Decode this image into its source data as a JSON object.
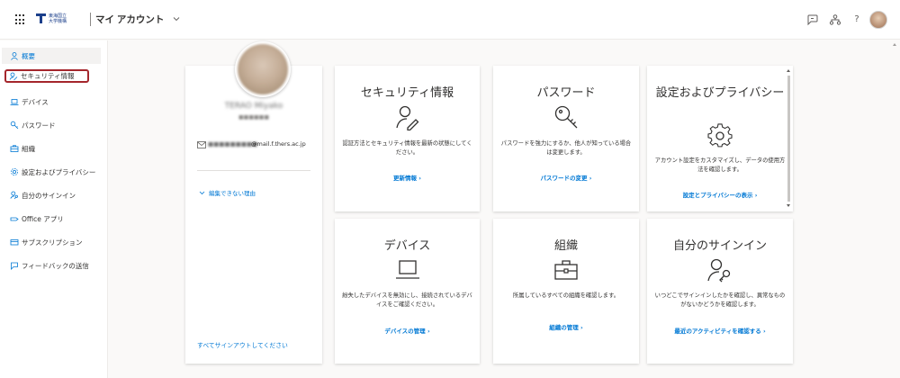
{
  "header": {
    "org_line1": "東海国立",
    "org_line2": "大学機構",
    "app_title": "マイ アカウント",
    "icons": [
      "waffle-icon",
      "feedback-icon",
      "org-chart-icon",
      "help-icon",
      "avatar"
    ],
    "help_label": "?"
  },
  "sidebar": {
    "items": [
      {
        "label": "概要",
        "icon": "person-icon"
      },
      {
        "label": "セキュリティ情報",
        "icon": "security-info-icon"
      },
      {
        "label": "デバイス",
        "icon": "laptop-icon"
      },
      {
        "label": "パスワード",
        "icon": "key-icon"
      },
      {
        "label": "組織",
        "icon": "briefcase-icon"
      },
      {
        "label": "設定およびプライバシー",
        "icon": "gear-icon"
      },
      {
        "label": "自分のサインイン",
        "icon": "signin-icon"
      },
      {
        "label": "Office アプリ",
        "icon": "office-apps-icon"
      },
      {
        "label": "サブスクリプション",
        "icon": "subscription-icon"
      },
      {
        "label": "フィードバックの送信",
        "icon": "feedback-icon"
      }
    ]
  },
  "profile": {
    "name": "TERAO Miyako",
    "subtitle": "■■■■■■",
    "email_local": "■■■■■■■■■",
    "email_domain": "@mail.f.thers.ac.jp",
    "why_cant_edit": "編集できない理由",
    "sign_out_everywhere": "すべてサインアウトしてください"
  },
  "tiles": [
    {
      "title": "セキュリティ情報",
      "icon": "security-info-icon",
      "desc": "認証方法とセキュリティ情報を最新の状態にしてください。",
      "link": "更新情報 ›"
    },
    {
      "title": "パスワード",
      "icon": "key-icon",
      "desc": "パスワードを強力にするか、他人が知っている場合は変更します。",
      "link": "パスワードの変更 ›"
    },
    {
      "title": "設定およびプライバシー",
      "icon": "gear-icon",
      "desc": "アカウント設定をカスタマイズし、データの使用方法を確認します。",
      "link": "設定とプライバシーの表示 ›"
    },
    {
      "title": "デバイス",
      "icon": "laptop-icon",
      "desc": "紛失したデバイスを無効にし、接続されているデバイスをご確認ください。",
      "link": "デバイスの管理 ›"
    },
    {
      "title": "組織",
      "icon": "briefcase-icon",
      "desc": "所属しているすべての組織を確認します。",
      "link": "組織の管理 ›"
    },
    {
      "title": "自分のサインイン",
      "icon": "signin-icon",
      "desc": "いつどこでサインインしたかを確認し、異常なものがないかどうかを確認します。",
      "link": "最近のアクティビティを確認する ›"
    }
  ],
  "colors": {
    "accent": "#0078d4",
    "highlight_border": "#a4262c",
    "text": "#323130"
  }
}
